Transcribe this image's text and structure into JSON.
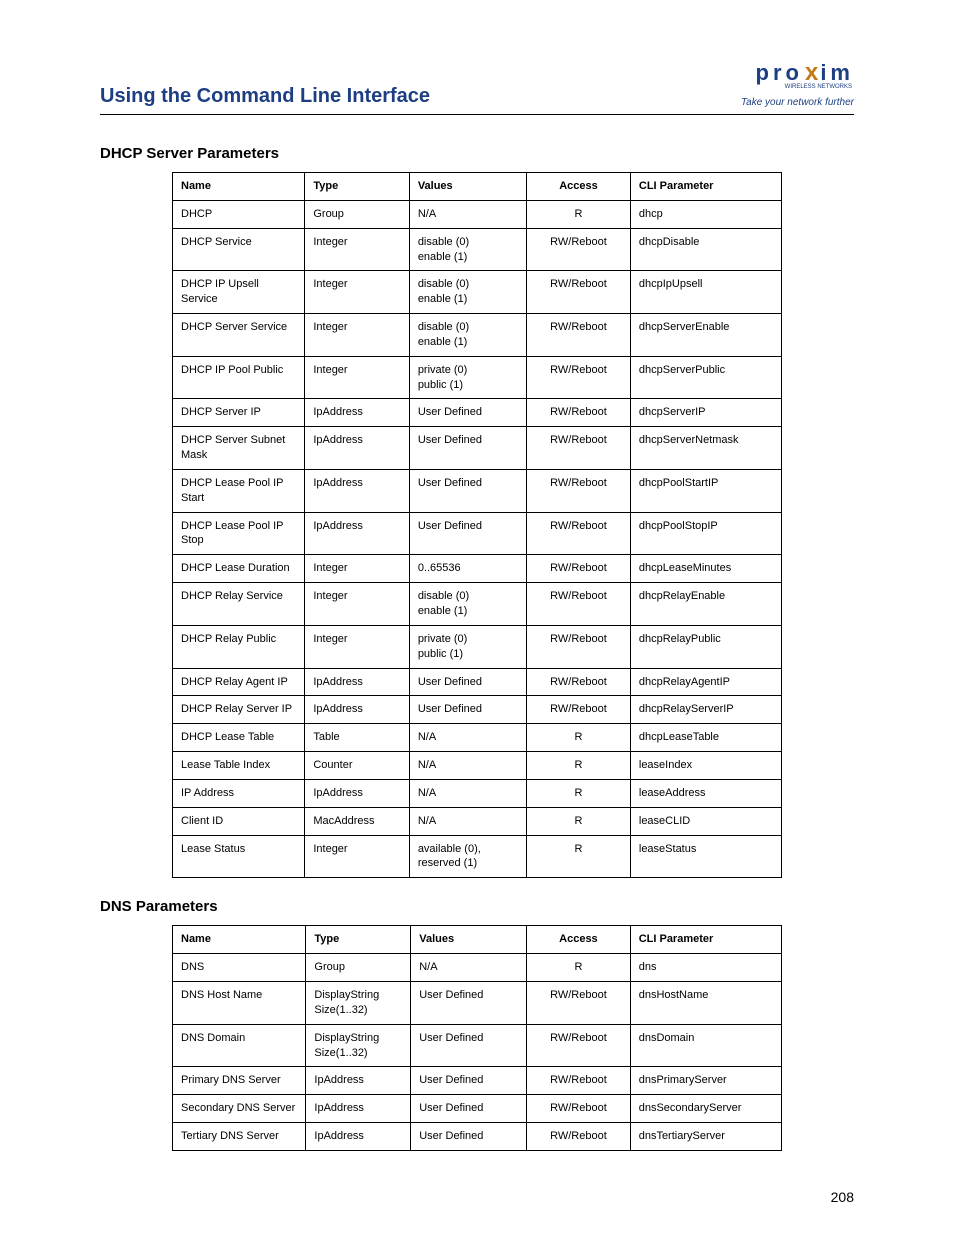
{
  "header": {
    "chapter_title": "Using the Command Line Interface",
    "brand_main_left": "pro",
    "brand_main_x": "x",
    "brand_main_right": "im",
    "brand_sub": "WIRELESS NETWORKS",
    "brand_tag": "Take your network further"
  },
  "columns": {
    "name": "Name",
    "type": "Type",
    "values": "Values",
    "access": "Access",
    "cli": "CLI Parameter"
  },
  "sections": [
    {
      "title": "DHCP Server Parameters",
      "rows": [
        {
          "name": "DHCP",
          "type": "Group",
          "values": "N/A",
          "access": "R",
          "cli": "dhcp"
        },
        {
          "name": "DHCP Service",
          "type": "Integer",
          "values": "disable (0)\nenable (1)",
          "access": "RW/Reboot",
          "cli": "dhcpDisable"
        },
        {
          "name": "DHCP IP Upsell Service",
          "type": "Integer",
          "values": "disable (0)\nenable (1)",
          "access": "RW/Reboot",
          "cli": "dhcpIpUpsell"
        },
        {
          "name": "DHCP Server Service",
          "type": "Integer",
          "values": "disable (0)\nenable (1)",
          "access": "RW/Reboot",
          "cli": "dhcpServerEnable"
        },
        {
          "name": "DHCP IP Pool Public",
          "type": "Integer",
          "values": "private (0)\npublic (1)",
          "access": "RW/Reboot",
          "cli": "dhcpServerPublic"
        },
        {
          "name": "DHCP Server IP",
          "type": "IpAddress",
          "values": "User Defined",
          "access": "RW/Reboot",
          "cli": "dhcpServerIP"
        },
        {
          "name": "DHCP Server Subnet Mask",
          "type": "IpAddress",
          "values": "User Defined",
          "access": "RW/Reboot",
          "cli": "dhcpServerNetmask"
        },
        {
          "name": "DHCP Lease Pool IP Start",
          "type": "IpAddress",
          "values": "User Defined",
          "access": "RW/Reboot",
          "cli": "dhcpPoolStartIP"
        },
        {
          "name": "DHCP Lease Pool IP Stop",
          "type": "IpAddress",
          "values": "User Defined",
          "access": "RW/Reboot",
          "cli": "dhcpPoolStopIP"
        },
        {
          "name": "DHCP Lease Duration",
          "type": "Integer",
          "values": "0..65536",
          "access": "RW/Reboot",
          "cli": "dhcpLeaseMinutes"
        },
        {
          "name": "DHCP Relay Service",
          "type": "Integer",
          "values": "disable (0)\nenable (1)",
          "access": "RW/Reboot",
          "cli": "dhcpRelayEnable"
        },
        {
          "name": "DHCP Relay Public",
          "type": "Integer",
          "values": "private (0)\npublic (1)",
          "access": "RW/Reboot",
          "cli": "dhcpRelayPublic"
        },
        {
          "name": "DHCP Relay Agent IP",
          "type": "IpAddress",
          "values": "User Defined",
          "access": "RW/Reboot",
          "cli": "dhcpRelayAgentIP"
        },
        {
          "name": "DHCP Relay Server IP",
          "type": "IpAddress",
          "values": "User Defined",
          "access": "RW/Reboot",
          "cli": "dhcpRelayServerIP"
        },
        {
          "name": "DHCP Lease Table",
          "type": "Table",
          "values": "N/A",
          "access": "R",
          "cli": "dhcpLeaseTable"
        },
        {
          "name": "Lease Table Index",
          "type": "Counter",
          "values": "N/A",
          "access": "R",
          "cli": "leaseIndex"
        },
        {
          "name": "IP Address",
          "type": "IpAddress",
          "values": "N/A",
          "access": "R",
          "cli": "leaseAddress"
        },
        {
          "name": "Client ID",
          "type": "MacAddress",
          "values": "N/A",
          "access": "R",
          "cli": "leaseCLID"
        },
        {
          "name": "Lease Status",
          "type": "Integer",
          "values": "available (0),\nreserved (1)",
          "access": "R",
          "cli": "leaseStatus"
        }
      ]
    },
    {
      "title": "DNS Parameters",
      "rows": [
        {
          "name": "DNS",
          "type": "Group",
          "values": "N/A",
          "access": "R",
          "cli": "dns"
        },
        {
          "name": "DNS Host Name",
          "type": "DisplayString\nSize(1..32)",
          "values": "User Defined",
          "access": "RW/Reboot",
          "cli": "dnsHostName"
        },
        {
          "name": "DNS Domain",
          "type": "DisplayString\nSize(1..32)",
          "values": "User Defined",
          "access": "RW/Reboot",
          "cli": "dnsDomain"
        },
        {
          "name": "Primary DNS Server",
          "type": "IpAddress",
          "values": "User Defined",
          "access": "RW/Reboot",
          "cli": "dnsPrimaryServer"
        },
        {
          "name": "Secondary DNS Server",
          "type": "IpAddress",
          "values": "User Defined",
          "access": "RW/Reboot",
          "cli": "dnsSecondaryServer"
        },
        {
          "name": "Tertiary DNS Server",
          "type": "IpAddress",
          "values": "User Defined",
          "access": "RW/Reboot",
          "cli": "dnsTertiaryServer"
        }
      ]
    }
  ],
  "page_number": "208"
}
